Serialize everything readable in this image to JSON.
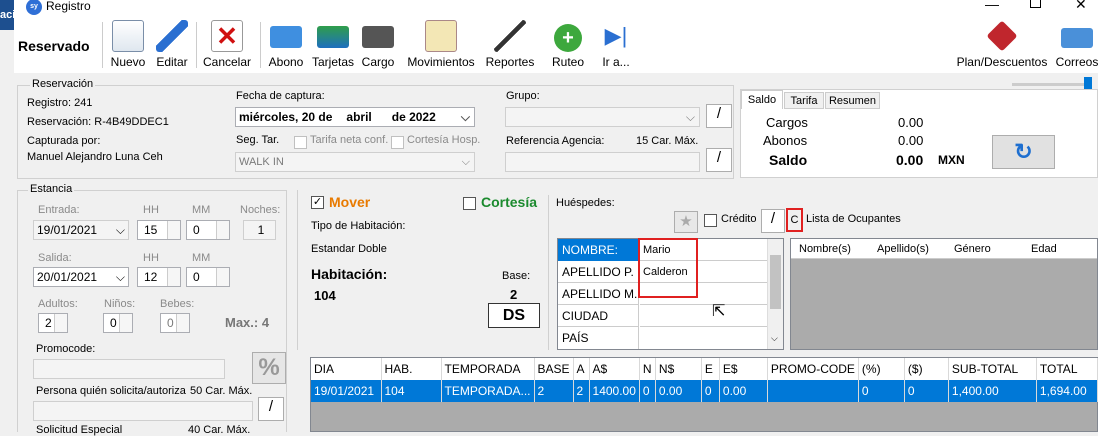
{
  "window": {
    "title": "Registro",
    "side_text": "aci",
    "app_icon": "sy"
  },
  "toolbar": {
    "status": "Reservado",
    "items": [
      "Nuevo",
      "Editar",
      "Cancelar",
      "Abono",
      "Tarjetas",
      "Cargo",
      "Movimientos",
      "Reportes",
      "Ruteo",
      "Ir a..."
    ],
    "right": [
      "Plan/Descuentos",
      "Correos"
    ]
  },
  "reservacion": {
    "legend": "Reservación",
    "registro": "Registro:  241",
    "reservacion": "Reservación:  R-4B49DDEC1",
    "capturada_por_label": "Capturada por:",
    "capturada_por": "Manuel Alejandro  Luna Ceh",
    "fecha_label": "Fecha de captura:",
    "fecha_day": "miércoles, 20 de",
    "fecha_month": "abril",
    "fecha_year": "de 2022",
    "grupo_label": "Grupo:",
    "seg_tar": "Seg. Tar.",
    "tarifa_neta": "Tarifa neta conf.",
    "cortesia_hosp": "Cortesía Hosp.",
    "walk_in": "WALK IN",
    "ref_agencia": "Referencia Agencia:",
    "car_max_15": "15 Car. Máx."
  },
  "saldo": {
    "tabs": [
      "Saldo",
      "Tarifa",
      "Resumen"
    ],
    "cargos_label": "Cargos",
    "cargos": "0.00",
    "abonos_label": "Abonos",
    "abonos": "0.00",
    "saldo_label": "Saldo",
    "saldo": "0.00",
    "currency": "MXN"
  },
  "estancia": {
    "legend": "Estancia",
    "entrada": "Entrada:",
    "hh": "HH",
    "mm": "MM",
    "noches": "Noches:",
    "entrada_date": "19/01/2021",
    "entrada_hh": "15",
    "entrada_mm": "0",
    "noches_val": "1",
    "salida": "Salida:",
    "salida_date": "20/01/2021",
    "salida_hh": "12",
    "salida_mm": "0",
    "adultos": "Adultos:",
    "ninos": "Niños:",
    "bebes": "Bebes:",
    "adultos_val": "2",
    "ninos_val": "0",
    "bebes_val": "0",
    "max": "Max.: 4",
    "promocode": "Promocode:",
    "persona": "Persona quién solicita/autoriza",
    "car_max_50": "50 Car. Máx.",
    "solicitud": "Solicitud Especial",
    "car_max_40": "40 Car. Máx."
  },
  "habitacion": {
    "mover": "Mover",
    "cortesia": "Cortesía",
    "tipo_label": "Tipo de Habitación:",
    "tipo": "Estandar Doble",
    "hab_label": "Habitación:",
    "hab": "104",
    "base_label": "Base:",
    "base": "2",
    "ds": "DS"
  },
  "huespedes": {
    "label": "Huéspedes:",
    "credito": "Crédito",
    "c_btn": "C",
    "lista": "Lista de Ocupantes",
    "fields": [
      {
        "k": "NOMBRE:",
        "v": "Mario"
      },
      {
        "k": "APELLIDO P.",
        "v": "Calderon"
      },
      {
        "k": "APELLIDO M.",
        "v": ""
      },
      {
        "k": "CIUDAD",
        "v": ""
      },
      {
        "k": "PAÍS",
        "v": ""
      }
    ],
    "occ_cols": [
      "Nombre(s)",
      "Apellido(s)",
      "Género",
      "Edad"
    ]
  },
  "tarifas": {
    "cols": [
      "DIA",
      "HAB.",
      "TEMPORADA",
      "BASE",
      "A",
      "A$",
      "N",
      "N$",
      "E",
      "E$",
      "PROMO-CODE",
      "(%)",
      "($)",
      "SUB-TOTAL",
      "TOTAL"
    ],
    "row": [
      "19/01/2021",
      "104",
      "TEMPORADA...",
      "2",
      "2",
      "1400.00",
      "0",
      "0.00",
      "0",
      "0.00",
      "",
      "0",
      "0",
      "1,400.00",
      "1,694.00"
    ]
  },
  "colors": {
    "accent": "#0078d7",
    "mover": "#e87a00",
    "cortesia": "#1b8a2e",
    "highlight": "#e02020"
  }
}
